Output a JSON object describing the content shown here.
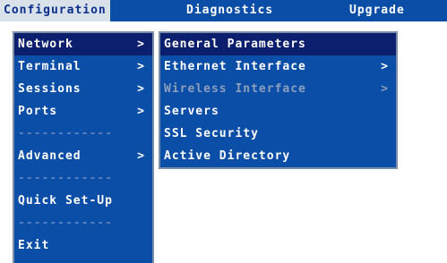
{
  "menubar": {
    "tabs": [
      {
        "label": "Configuration"
      },
      {
        "label": "Diagnostics"
      },
      {
        "label": "Upgrade"
      }
    ]
  },
  "main_menu": {
    "items": [
      {
        "label": "Network",
        "arrow": ">"
      },
      {
        "label": "Terminal",
        "arrow": ">"
      },
      {
        "label": "Sessions",
        "arrow": ">"
      },
      {
        "label": "Ports",
        "arrow": ">"
      },
      {
        "separator": "------------"
      },
      {
        "label": "Advanced",
        "arrow": ">"
      },
      {
        "separator": "------------"
      },
      {
        "label": "Quick Set-Up"
      },
      {
        "separator": "------------"
      },
      {
        "label": "Exit"
      }
    ]
  },
  "network_submenu": {
    "items": [
      {
        "label": "General Parameters"
      },
      {
        "label": "Ethernet Interface",
        "arrow": ">"
      },
      {
        "label": "Wireless Interface",
        "arrow": ">"
      },
      {
        "label": "Servers"
      },
      {
        "label": "SSL Security"
      },
      {
        "label": "Active Directory"
      }
    ]
  }
}
